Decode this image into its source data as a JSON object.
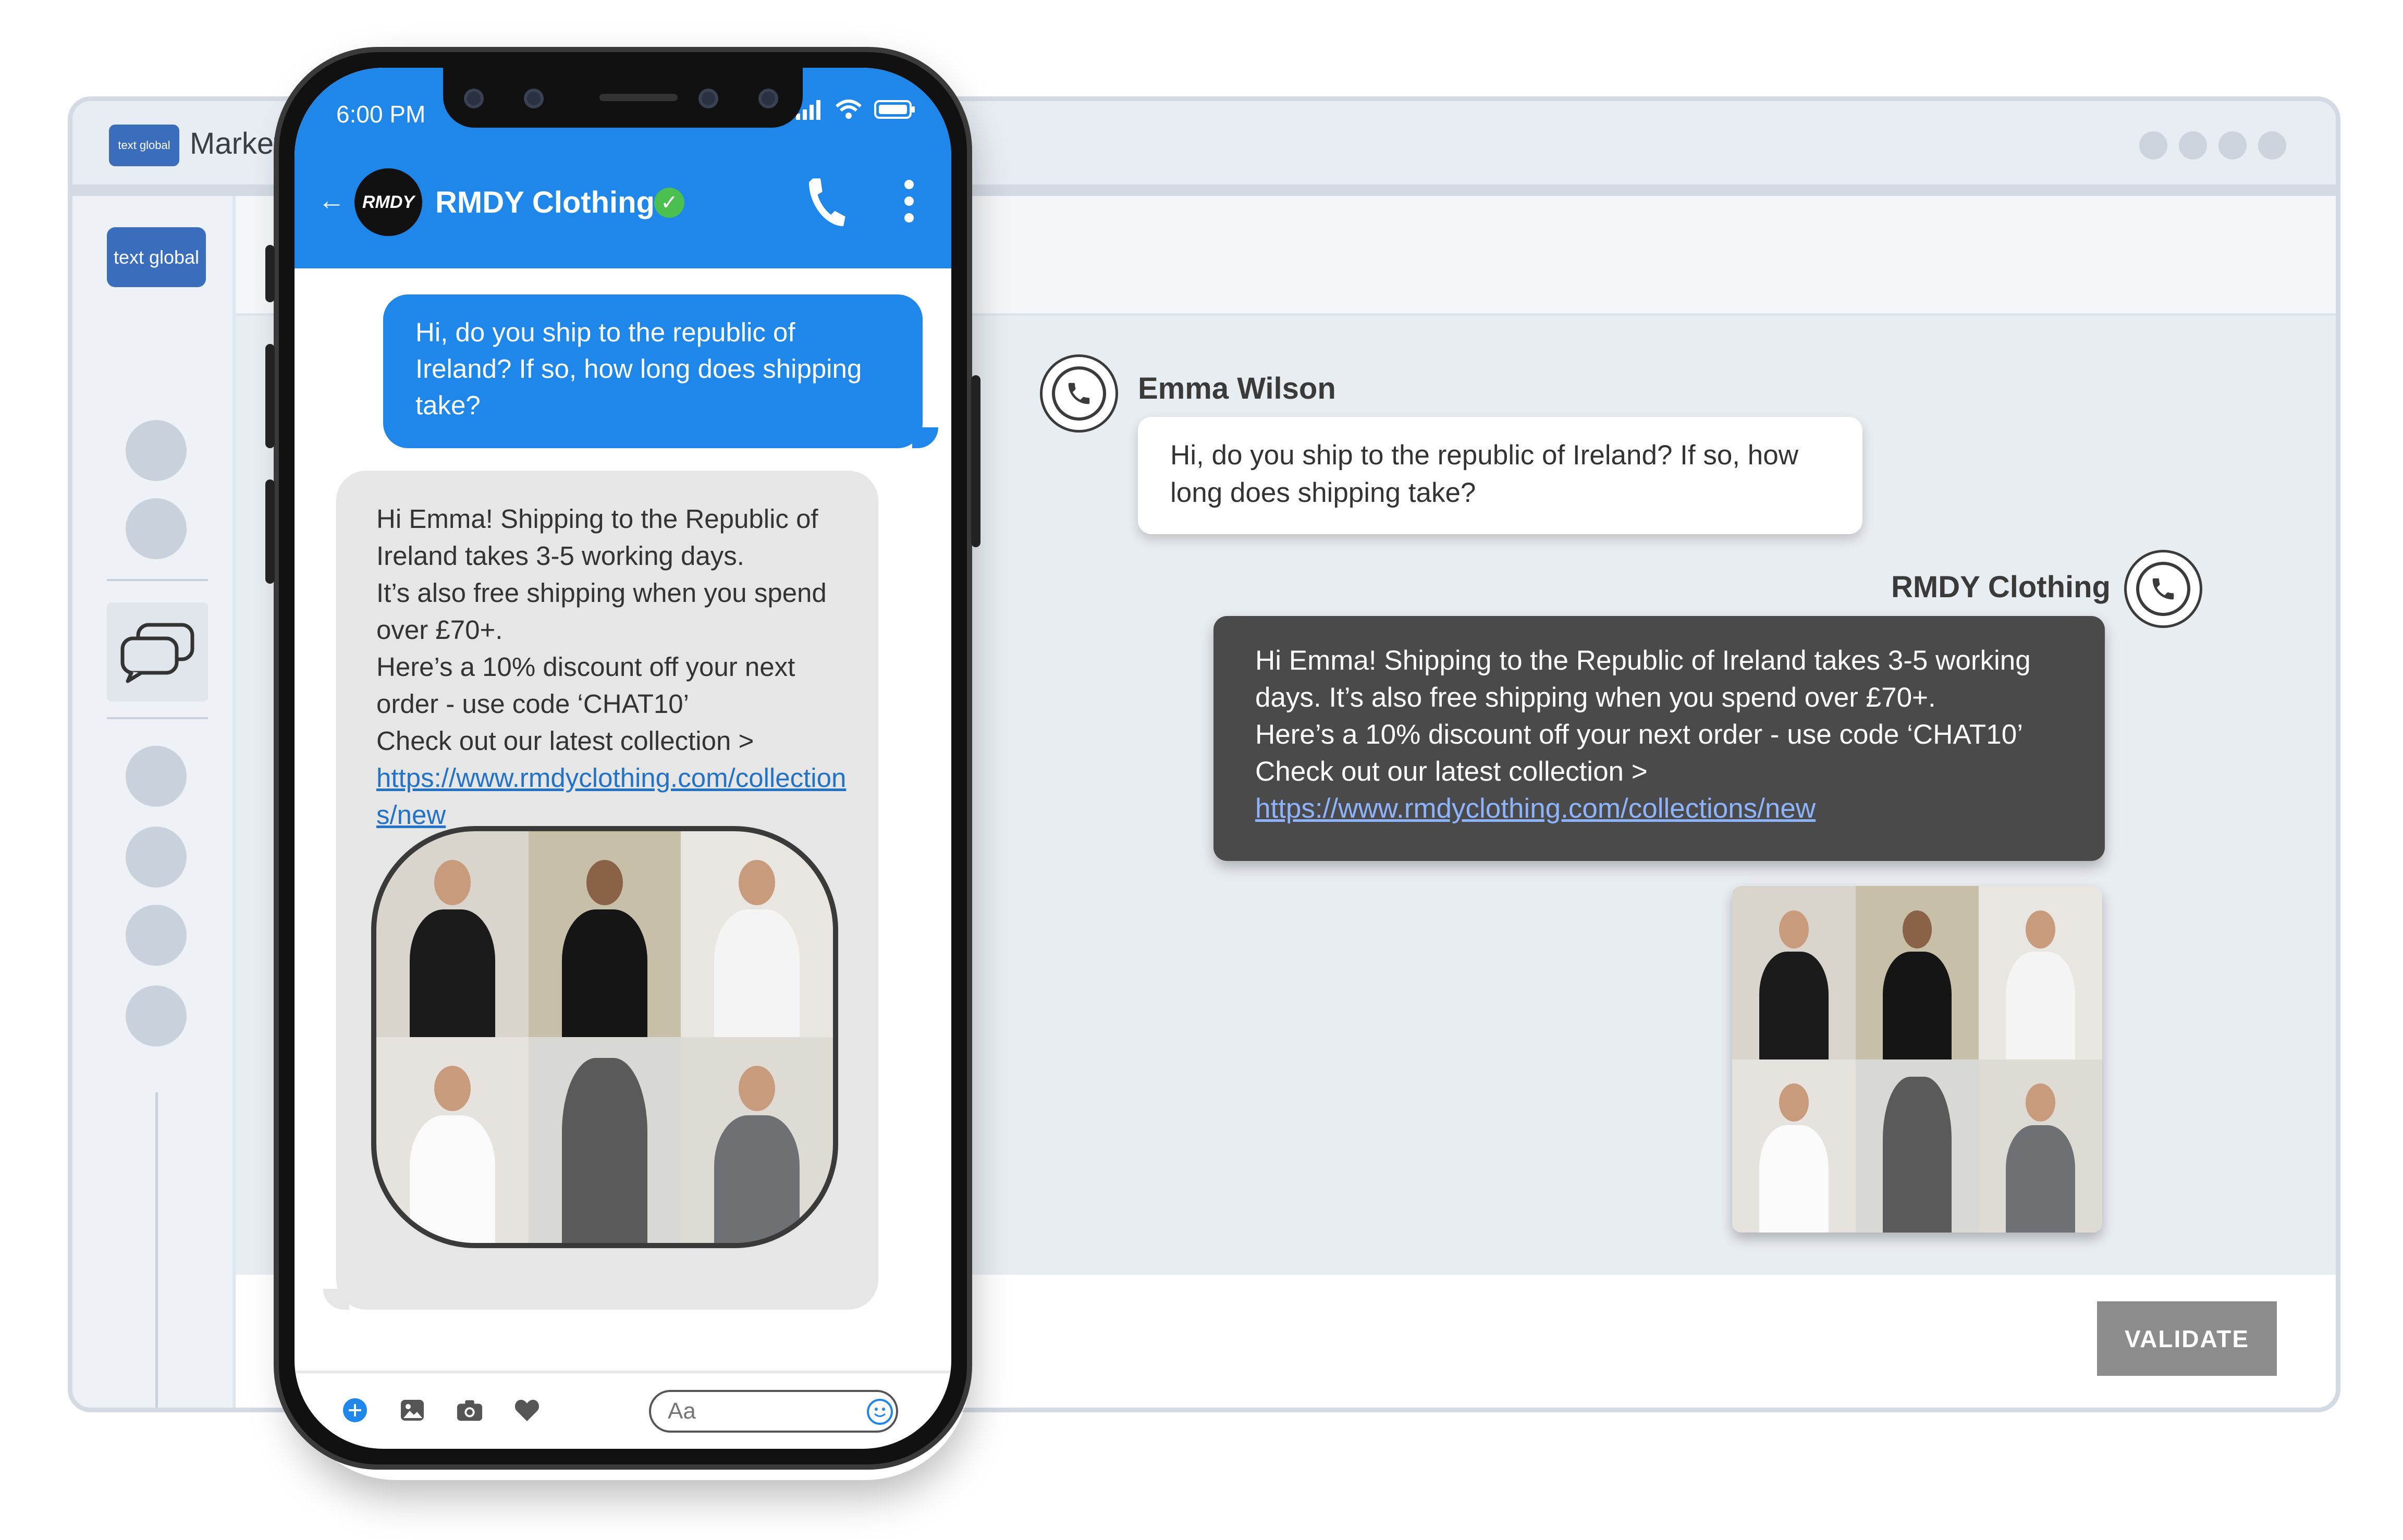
{
  "app_window": {
    "brand_logo_text": "text global",
    "title": "Market",
    "sidebar_logo_text": "text global",
    "validate_label": "VALIDATE"
  },
  "conversation": {
    "customer_name": "Emma Wilson",
    "customer_message": "Hi, do you ship to the republic of Ireland? If so, how long does shipping take?",
    "business_name": "RMDY Clothing",
    "business_reply_lines": [
      "Hi Emma! Shipping to the Republic of Ireland takes 3-5 working days. It’s also free shipping when you spend over £70+.",
      "Here’s a 10% discount off your next order - use code ‘CHAT10’",
      "Check out our latest collection >"
    ],
    "business_reply_link": "https://www.rmdyclothing.com/collections/new"
  },
  "phone": {
    "status_time": "6:00 PM",
    "contact_avatar_text": "RMDY",
    "contact_name": "RMDY Clothing",
    "outgoing_message": "Hi, do you ship to the republic of Ireland? If so, how long does shipping take?",
    "incoming_lines": [
      "Hi Emma! Shipping to the Republic of Ireland takes 3-5 working days.",
      "It’s also free shipping when you spend over £70+.",
      "Here’s a 10% discount off your next order - use code ‘CHAT10’",
      "Check out our latest collection >"
    ],
    "incoming_link": "https://www.rmdyclothing.com/collections/new",
    "compose_placeholder": "Aa"
  },
  "colors": {
    "messenger_blue": "#1f87ea",
    "dark_bubble": "#4a4a4a",
    "validate_gray": "#8c8c8c",
    "verified_green": "#4cbf51"
  }
}
